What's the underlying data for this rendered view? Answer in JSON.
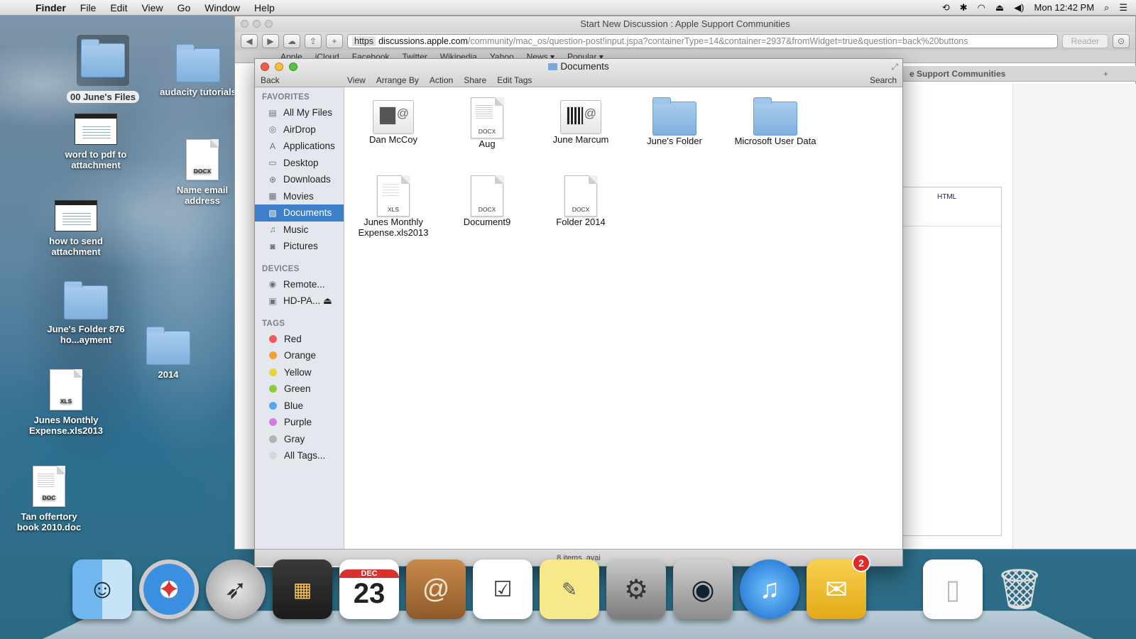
{
  "menubar": {
    "app": "Finder",
    "items": [
      "File",
      "Edit",
      "View",
      "Go",
      "Window",
      "Help"
    ],
    "clock": "Mon 12:42 PM"
  },
  "browser": {
    "title": "Start New Discussion : Apple Support Communities",
    "url_scheme": "https",
    "url_domain": "discussions.apple.com",
    "url_path": "/community/mac_os/question-post!input.jspa?containerType=14&container=2937&fromWidget=true&question=back%20buttons",
    "reader": "Reader",
    "bookmarks": [
      "Apple",
      "iCloud",
      "Facebook",
      "Twitter",
      "Wikipedia",
      "Yahoo",
      "News ▾",
      "Popular ▾"
    ],
    "tab_title": "e Support Communities",
    "tab_plus": "+",
    "editor_html": "HTML"
  },
  "finder": {
    "title": "Documents",
    "back": "Back",
    "actions": [
      "View",
      "Arrange By",
      "Action",
      "Share",
      "Edit Tags"
    ],
    "search": "Search",
    "sections": {
      "favorites": "FAVORITES",
      "devices": "DEVICES",
      "tags": "TAGS"
    },
    "favorites": [
      "All My Files",
      "AirDrop",
      "Applications",
      "Desktop",
      "Downloads",
      "Movies",
      "Documents",
      "Music",
      "Pictures"
    ],
    "devices": [
      "Remote...",
      "HD-PA... ⏏"
    ],
    "tags": [
      {
        "label": "Red",
        "color": "#f05a5a"
      },
      {
        "label": "Orange",
        "color": "#f6a12b"
      },
      {
        "label": "Yellow",
        "color": "#ecd430"
      },
      {
        "label": "Green",
        "color": "#8ccc3b"
      },
      {
        "label": "Blue",
        "color": "#5aa8ec"
      },
      {
        "label": "Purple",
        "color": "#d67be6"
      },
      {
        "label": "Gray",
        "color": "#b3b3b3"
      },
      {
        "label": "All Tags...",
        "color": "#d6d6d6"
      }
    ],
    "files": [
      {
        "name": "Dan McCoy",
        "kind": "card"
      },
      {
        "name": "Aug",
        "kind": "DOCX"
      },
      {
        "name": "June Marcum",
        "kind": "card"
      },
      {
        "name": "June's Folder",
        "kind": "folder"
      },
      {
        "name": "Microsoft User Data",
        "kind": "folder"
      },
      {
        "name": "Junes Monthly Expense.xls2013",
        "kind": "XLS"
      },
      {
        "name": "Document9",
        "kind": "DOCX"
      },
      {
        "name": "Folder 2014",
        "kind": "DOCX"
      }
    ],
    "status": "8 items, avai"
  },
  "desktop": {
    "icons": [
      {
        "label": "00 June's Files"
      },
      {
        "label": "audacity tutorials"
      },
      {
        "label": "word to pdf to attachment"
      },
      {
        "label": "Name       email address"
      },
      {
        "label": "how to send attachment"
      },
      {
        "label": "June's Folder 876 ho...ayment"
      },
      {
        "label": "2014"
      },
      {
        "label": "Junes Monthly Expense.xls2013"
      },
      {
        "label": "Tan offertory book 2010.doc"
      }
    ],
    "doc_labels": {
      "docx": "DOCX",
      "xls": "XLS",
      "doc": "DOC"
    }
  },
  "dock": {
    "calendar_month": "DEC",
    "calendar_day": "23",
    "mail_badge": "2"
  }
}
